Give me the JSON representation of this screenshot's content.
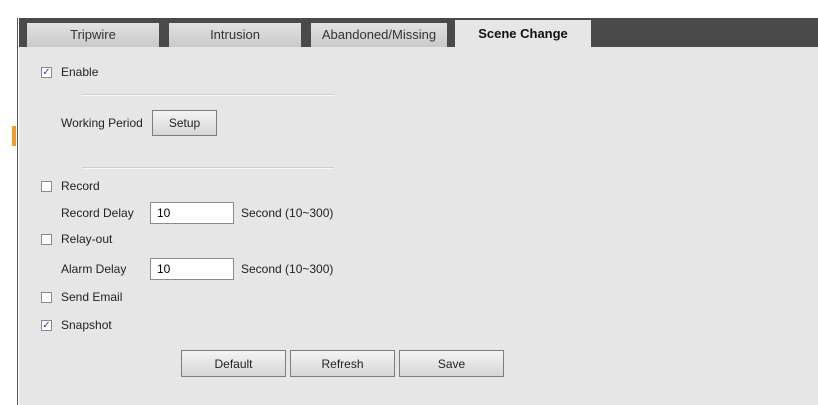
{
  "tabs": [
    {
      "label": "Tripwire"
    },
    {
      "label": "Intrusion"
    },
    {
      "label": "Abandoned/Missing"
    },
    {
      "label": "Scene Change",
      "active": true
    }
  ],
  "enable": {
    "label": "Enable",
    "checked": true
  },
  "working_period": {
    "label": "Working Period",
    "button": "Setup"
  },
  "record": {
    "label": "Record",
    "checked": false
  },
  "record_delay": {
    "label": "Record Delay",
    "value": "10",
    "unit": "Second (10~300)"
  },
  "relay_out": {
    "label": "Relay-out",
    "checked": false
  },
  "alarm_delay": {
    "label": "Alarm Delay",
    "value": "10",
    "unit": "Second (10~300)"
  },
  "send_email": {
    "label": "Send Email",
    "checked": false
  },
  "snapshot": {
    "label": "Snapshot",
    "checked": true
  },
  "actions": {
    "default": "Default",
    "refresh": "Refresh",
    "save": "Save"
  },
  "colors": {
    "tabbar": "#4a4a4a",
    "panel": "#e6e6e6",
    "check": "#2a4d9a",
    "side_marker": "#f39c2a"
  },
  "icons": {
    "checked": "checkmark-icon"
  }
}
